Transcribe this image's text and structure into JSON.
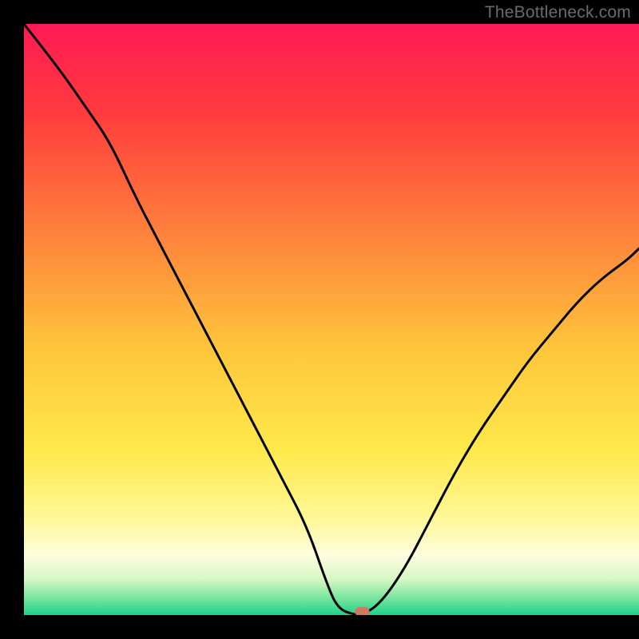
{
  "watermark": "TheBottleneck.com",
  "chart_data": {
    "type": "line",
    "title": "",
    "xlabel": "",
    "ylabel": "",
    "xlim": [
      0,
      100
    ],
    "ylim": [
      0,
      100
    ],
    "x": [
      0,
      6,
      10,
      14,
      18,
      22,
      26,
      30,
      34,
      38,
      42,
      46,
      49,
      51,
      54,
      55,
      58,
      62,
      66,
      70,
      74,
      78,
      82,
      86,
      90,
      94,
      98,
      100
    ],
    "values": [
      100,
      92,
      86,
      80,
      71,
      63,
      55,
      47,
      39,
      31,
      23,
      15,
      6,
      1,
      0,
      0,
      2,
      8,
      16,
      24,
      31,
      37,
      43,
      48,
      53,
      57,
      60,
      62
    ],
    "gradient_stops": [
      {
        "offset": 0.0,
        "color": "#ff1a55"
      },
      {
        "offset": 0.15,
        "color": "#ff3b3d"
      },
      {
        "offset": 0.35,
        "color": "#ff803c"
      },
      {
        "offset": 0.55,
        "color": "#ffc63c"
      },
      {
        "offset": 0.72,
        "color": "#ffe94a"
      },
      {
        "offset": 0.84,
        "color": "#fff89a"
      },
      {
        "offset": 0.9,
        "color": "#fffde0"
      },
      {
        "offset": 0.94,
        "color": "#d6f7c4"
      },
      {
        "offset": 0.97,
        "color": "#7be6a0"
      },
      {
        "offset": 1.0,
        "color": "#1fd18a"
      }
    ],
    "marker": {
      "x": 55.0,
      "y": 0.6,
      "color": "#d4765e"
    }
  }
}
